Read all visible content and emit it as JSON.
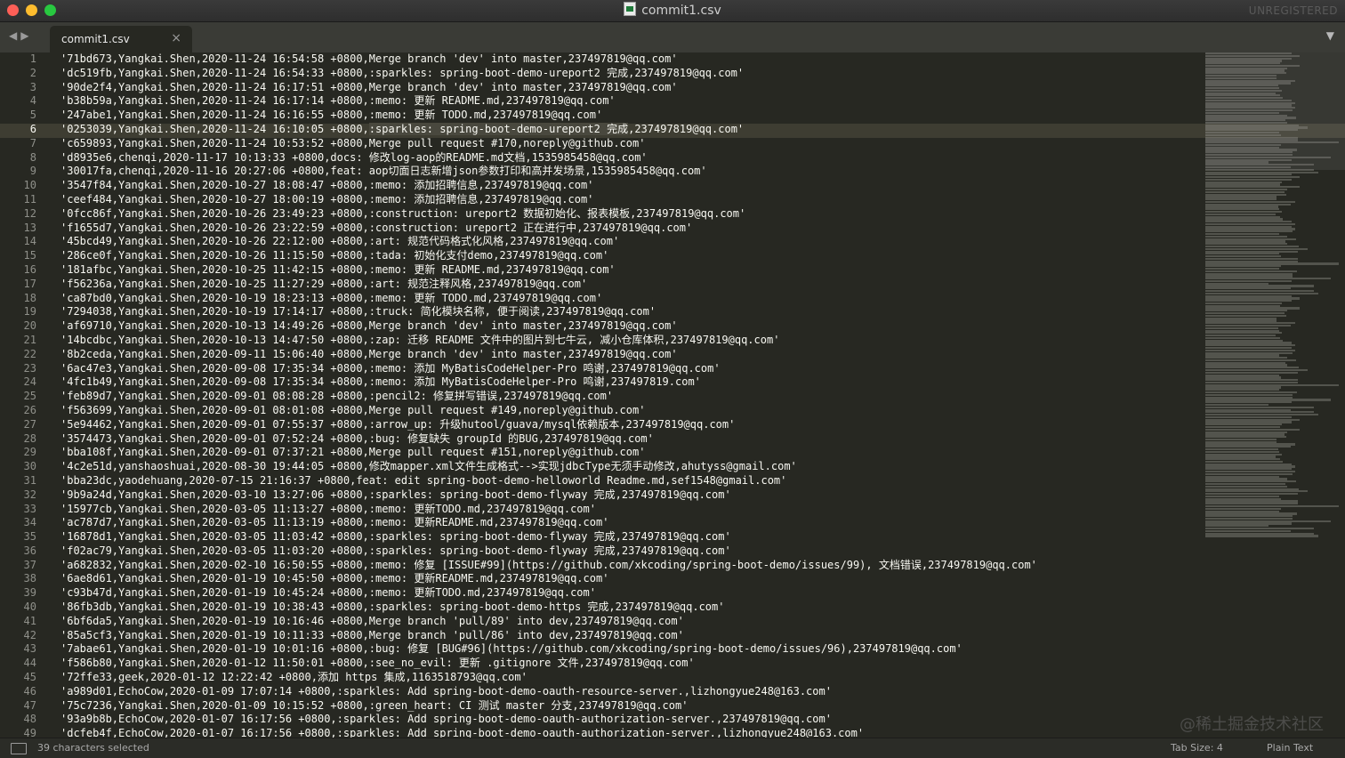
{
  "window": {
    "title": "commit1.csv",
    "unregistered": "UNREGISTERED"
  },
  "tab": {
    "label": "commit1.csv",
    "close_icon": "×"
  },
  "editor": {
    "active_line": 6,
    "lines": [
      "'71bd673,Yangkai.Shen,2020-11-24 16:54:58 +0800,Merge branch 'dev' into master,237497819@qq.com'",
      "'dc519fb,Yangkai.Shen,2020-11-24 16:54:33 +0800,:sparkles: spring-boot-demo-ureport2 完成,237497819@qq.com'",
      "'90de2f4,Yangkai.Shen,2020-11-24 16:17:51 +0800,Merge branch 'dev' into master,237497819@qq.com'",
      "'b38b59a,Yangkai.Shen,2020-11-24 16:17:14 +0800,:memo: 更新 README.md,237497819@qq.com'",
      "'247abe1,Yangkai.Shen,2020-11-24 16:16:55 +0800,:memo: 更新 TODO.md,237497819@qq.com'",
      "'0253039,Yangkai.Shen,2020-11-24 16:10:05 +0800,:sparkles: spring-boot-demo-ureport2 完成,237497819@qq.com'",
      "'c659893,Yangkai.Shen,2020-11-24 10:53:52 +0800,Merge pull request #170,noreply@github.com'",
      "'d8935e6,chenqi,2020-11-17 10:13:33 +0800,docs: 修改log-aop的README.md文档,1535985458@qq.com'",
      "'30017fa,chenqi,2020-11-16 20:27:06 +0800,feat: aop切面日志新增json参数打印和高并发场景,1535985458@qq.com'",
      "'3547f84,Yangkai.Shen,2020-10-27 18:08:47 +0800,:memo: 添加招聘信息,237497819@qq.com'",
      "'ceef484,Yangkai.Shen,2020-10-27 18:00:19 +0800,:memo: 添加招聘信息,237497819@qq.com'",
      "'0fcc86f,Yangkai.Shen,2020-10-26 23:49:23 +0800,:construction: ureport2 数据初始化、报表模板,237497819@qq.com'",
      "'f1655d7,Yangkai.Shen,2020-10-26 23:22:59 +0800,:construction: ureport2 正在进行中,237497819@qq.com'",
      "'45bcd49,Yangkai.Shen,2020-10-26 22:12:00 +0800,:art: 规范代码格式化风格,237497819@qq.com'",
      "'286ce0f,Yangkai.Shen,2020-10-26 11:15:50 +0800,:tada: 初始化支付demo,237497819@qq.com'",
      "'181afbc,Yangkai.Shen,2020-10-25 11:42:15 +0800,:memo: 更新 README.md,237497819@qq.com'",
      "'f56236a,Yangkai.Shen,2020-10-25 11:27:29 +0800,:art: 规范注释风格,237497819@qq.com'",
      "'ca87bd0,Yangkai.Shen,2020-10-19 18:23:13 +0800,:memo: 更新 TODO.md,237497819@qq.com'",
      "'7294038,Yangkai.Shen,2020-10-19 17:14:17 +0800,:truck: 简化模块名称, 便于阅读,237497819@qq.com'",
      "'af69710,Yangkai.Shen,2020-10-13 14:49:26 +0800,Merge branch 'dev' into master,237497819@qq.com'",
      "'14bcdbc,Yangkai.Shen,2020-10-13 14:47:50 +0800,:zap: 迁移 README 文件中的图片到七牛云, 减小仓库体积,237497819@qq.com'",
      "'8b2ceda,Yangkai.Shen,2020-09-11 15:06:40 +0800,Merge branch 'dev' into master,237497819@qq.com'",
      "'6ac47e3,Yangkai.Shen,2020-09-08 17:35:34 +0800,:memo: 添加 MyBatisCodeHelper-Pro 鸣谢,237497819@qq.com'",
      "'4fc1b49,Yangkai.Shen,2020-09-08 17:35:34 +0800,:memo: 添加 MyBatisCodeHelper-Pro 鸣谢,237497819.com'",
      "'feb89d7,Yangkai.Shen,2020-09-01 08:08:28 +0800,:pencil2: 修复拼写错误,237497819@qq.com'",
      "'f563699,Yangkai.Shen,2020-09-01 08:01:08 +0800,Merge pull request #149,noreply@github.com'",
      "'5e94462,Yangkai.Shen,2020-09-01 07:55:37 +0800,:arrow_up: 升级hutool/guava/mysql依赖版本,237497819@qq.com'",
      "'3574473,Yangkai.Shen,2020-09-01 07:52:24 +0800,:bug: 修复缺失 groupId 的BUG,237497819@qq.com'",
      "'bba108f,Yangkai.Shen,2020-09-01 07:37:21 +0800,Merge pull request #151,noreply@github.com'",
      "'4c2e51d,yanshaoshuai,2020-08-30 19:44:05 +0800,修改mapper.xml文件生成格式-->实现jdbcType无须手动修改,ahutyss@gmail.com'",
      "'bba23dc,yaodehuang,2020-07-15 21:16:37 +0800,feat: edit spring-boot-demo-helloworld Readme.md,sef1548@gmail.com'",
      "'9b9a24d,Yangkai.Shen,2020-03-10 13:27:06 +0800,:sparkles: spring-boot-demo-flyway 完成,237497819@qq.com'",
      "'15977cb,Yangkai.Shen,2020-03-05 11:13:27 +0800,:memo: 更新TODO.md,237497819@qq.com'",
      "'ac787d7,Yangkai.Shen,2020-03-05 11:13:19 +0800,:memo: 更新README.md,237497819@qq.com'",
      "'16878d1,Yangkai.Shen,2020-03-05 11:03:42 +0800,:sparkles: spring-boot-demo-flyway 完成,237497819@qq.com'",
      "'f02ac79,Yangkai.Shen,2020-03-05 11:03:20 +0800,:sparkles: spring-boot-demo-flyway 完成,237497819@qq.com'",
      "'a682832,Yangkai.Shen,2020-02-10 16:50:55 +0800,:memo: 修复 [ISSUE#99](https://github.com/xkcoding/spring-boot-demo/issues/99), 文档错误,237497819@qq.com'",
      "'6ae8d61,Yangkai.Shen,2020-01-19 10:45:50 +0800,:memo: 更新README.md,237497819@qq.com'",
      "'c93b47d,Yangkai.Shen,2020-01-19 10:45:24 +0800,:memo: 更新TODO.md,237497819@qq.com'",
      "'86fb3db,Yangkai.Shen,2020-01-19 10:38:43 +0800,:sparkles: spring-boot-demo-https 完成,237497819@qq.com'",
      "'6bf6da5,Yangkai.Shen,2020-01-19 10:16:46 +0800,Merge branch 'pull/89' into dev,237497819@qq.com'",
      "'85a5cf3,Yangkai.Shen,2020-01-19 10:11:33 +0800,Merge branch 'pull/86' into dev,237497819@qq.com'",
      "'7abae61,Yangkai.Shen,2020-01-19 10:01:16 +0800,:bug: 修复 [BUG#96](https://github.com/xkcoding/spring-boot-demo/issues/96),237497819@qq.com'",
      "'f586b80,Yangkai.Shen,2020-01-12 11:50:01 +0800,:see_no_evil: 更新 .gitignore 文件,237497819@qq.com'",
      "'72ffe33,geek,2020-01-12 12:22:42 +0800,添加 https 集成,1163518793@qq.com'",
      "'a989d01,EchoCow,2020-01-09 17:07:14 +0800,:sparkles: Add spring-boot-demo-oauth-resource-server.,lizhongyue248@163.com'",
      "'75c7236,Yangkai.Shen,2020-01-09 10:15:52 +0800,:green_heart: CI 测试 master 分支,237497819@qq.com'",
      "'93a9b8b,EchoCow,2020-01-07 16:17:56 +0800,:sparkles: Add spring-boot-demo-oauth-authorization-server.,237497819@qq.com'",
      "'dcfeb4f,EchoCow,2020-01-07 16:17:56 +0800,:sparkles: Add spring-boot-demo-oauth-authorization-server.,lizhongyue248@163.com'"
    ]
  },
  "status": {
    "selection": "39 characters selected",
    "tab_size": "Tab Size: 4",
    "syntax": "Plain Text"
  },
  "watermark": "@稀土掘金技术社区",
  "colors": {
    "editor_bg": "#272822",
    "text": "#f8f8f2",
    "line_number": "#8f908a",
    "active_line_bg": "#3e3d32"
  }
}
